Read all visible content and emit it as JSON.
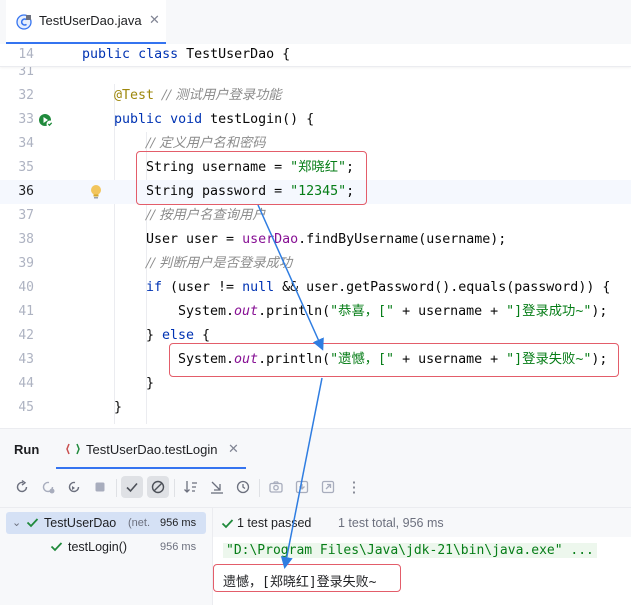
{
  "editor_tab": {
    "title": "TestUserDao.java",
    "close": "✕"
  },
  "code": {
    "sticky": {
      "line": "14",
      "kw1": "public",
      "kw2": "class",
      "name": "TestUserDao {"
    },
    "lines": [
      {
        "n": "31"
      },
      {
        "n": "32",
        "ann": "@Test",
        "cmt": "// 测试用户登录功能"
      },
      {
        "n": "33",
        "kw1": "public",
        "kw2": "void",
        "rest": "testLogin() {"
      },
      {
        "n": "34",
        "cmt": "// 定义用户名和密码"
      },
      {
        "n": "35",
        "pre": "String username = ",
        "str": "\"郑晓红\"",
        "post": ";"
      },
      {
        "n": "36",
        "pre": "String password = ",
        "str": "\"12345\"",
        "post": ";"
      },
      {
        "n": "37",
        "cmt": "// 按用户名查询用户"
      },
      {
        "n": "38",
        "pre": "User user = ",
        "fld": "userDao",
        "post": ".findByUsername(username);"
      },
      {
        "n": "39",
        "cmt": "// 判断用户是否登录成功"
      },
      {
        "n": "40",
        "kw": "if",
        "a": " (user != ",
        "kw2": "null",
        "b": " && user.getPassword().equals(password)) {"
      },
      {
        "n": "41",
        "a": "System.",
        "sfld": "out",
        "b": ".println(",
        "str": "\"恭喜，[\"",
        "c": " + username + ",
        "str2": "\"]登录成功~\"",
        "d": ");"
      },
      {
        "n": "42",
        "a": "} ",
        "kw": "else",
        "b": " {"
      },
      {
        "n": "43",
        "a": "System.",
        "sfld": "out",
        "b": ".println(",
        "str": "\"遗憾，[\"",
        "c": " + username + ",
        "str2": "\"]登录失败~\"",
        "d": ");"
      },
      {
        "n": "44",
        "a": "}"
      },
      {
        "n": "45",
        "a": "}"
      }
    ]
  },
  "run_panel": {
    "label": "Run",
    "tab_title": "TestUserDao.testLogin",
    "tab_close": "✕",
    "tree": [
      {
        "name": "TestUserDao",
        "detail": "(net.",
        "time": "956 ms"
      },
      {
        "name": "testLogin()",
        "time": "956 ms"
      }
    ],
    "status": {
      "passed": "1 test passed",
      "total": "1 test total, 956 ms"
    },
    "console": {
      "line1": "\"D:\\Program Files\\Java\\jdk-21\\bin\\java.exe\" ...",
      "line2": "遗憾，[郑晓红]登录失败~"
    },
    "more": "⋮"
  },
  "colors": {
    "accent": "#3574f0",
    "highlight_box": "#e35d6a",
    "pass_green": "#208a3c",
    "arrow": "#2f7de1"
  }
}
